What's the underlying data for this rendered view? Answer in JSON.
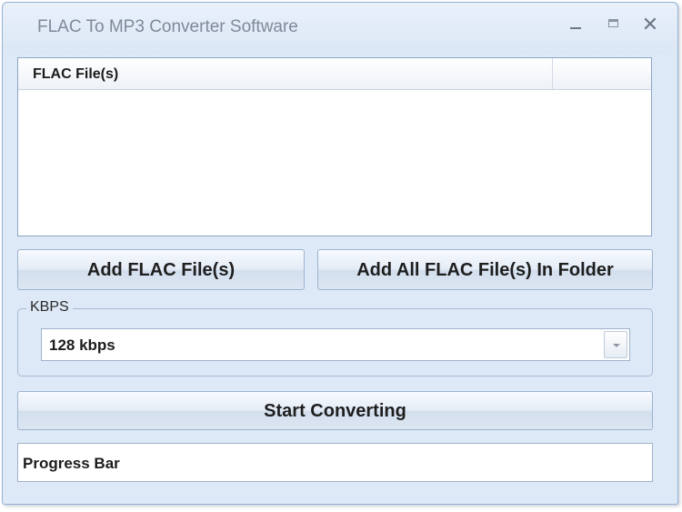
{
  "window": {
    "title": "FLAC To MP3 Converter Software",
    "controls": {
      "minimize": "minimize-icon",
      "maximize": "maximize-icon",
      "close": "close-icon"
    }
  },
  "file_list": {
    "columns": [
      "FLAC File(s)",
      ""
    ],
    "rows": []
  },
  "buttons": {
    "add_files": "Add FLAC File(s)",
    "add_folder": "Add All FLAC File(s) In Folder",
    "start": "Start Converting"
  },
  "kbps": {
    "label": "KBPS",
    "selected": "128 kbps"
  },
  "progress": {
    "text": "Progress Bar"
  },
  "colors": {
    "window_bg": "#dde9f6",
    "border": "#97b2d4",
    "title_text": "#7f8a98"
  }
}
